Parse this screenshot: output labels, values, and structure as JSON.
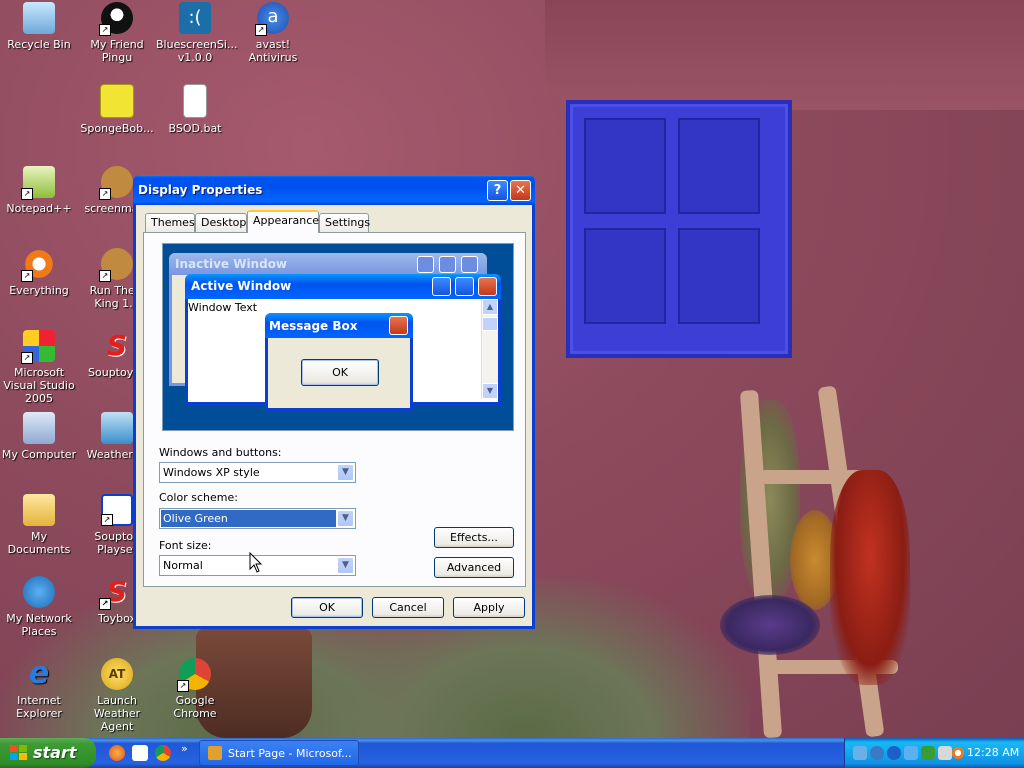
{
  "desktop_icons": [
    {
      "label": "Recycle Bin"
    },
    {
      "label": "My Friend Pingu"
    },
    {
      "label": "BluescreenSi... v1.0.0"
    },
    {
      "label": "avast! Antivirus"
    },
    {
      "label": "SpongeBob..."
    },
    {
      "label": "BSOD.bat"
    },
    {
      "label": "Notepad++"
    },
    {
      "label": "screenmate"
    },
    {
      "label": "Everything"
    },
    {
      "label": "Run The L King 1.5"
    },
    {
      "label": "Microsoft Visual Studio 2005"
    },
    {
      "label": "Souptoys1"
    },
    {
      "label": "My Computer"
    },
    {
      "label": "WeatherAg"
    },
    {
      "label": "My Documents"
    },
    {
      "label": "Souptoy Playset"
    },
    {
      "label": "My Network Places"
    },
    {
      "label": "Toybox"
    },
    {
      "label": "Internet Explorer"
    },
    {
      "label": "Launch Weather Agent"
    },
    {
      "label": "Google Chrome"
    }
  ],
  "dialog": {
    "title": "Display Properties",
    "help_glyph": "?",
    "close_glyph": "✕",
    "tabs": [
      "Themes",
      "Desktop",
      "Appearance",
      "Settings"
    ],
    "active_tab": "Appearance",
    "preview": {
      "inactive_title": "Inactive Window",
      "active_title": "Active Window",
      "window_text": "Window Text",
      "msgbox_title": "Message Box",
      "msgbox_ok": "OK"
    },
    "windows_buttons_label": "Windows and buttons:",
    "windows_buttons_value": "Windows XP style",
    "color_scheme_label": "Color scheme:",
    "color_scheme_value": "Olive Green",
    "font_size_label": "Font size:",
    "font_size_value": "Normal",
    "effects_label": "Effects...",
    "advanced_label": "Advanced",
    "ok_label": "OK",
    "cancel_label": "Cancel",
    "apply_label": "Apply"
  },
  "taskbar": {
    "start_label": "start",
    "chevron": "»",
    "task_label": "Start Page - Microsof...",
    "clock": "12:28 AM"
  },
  "colors": {
    "title_blue": "#0053ee",
    "start_green": "#3c9b34",
    "selection": "#316ac5",
    "tray_blue": "#1191e5"
  }
}
